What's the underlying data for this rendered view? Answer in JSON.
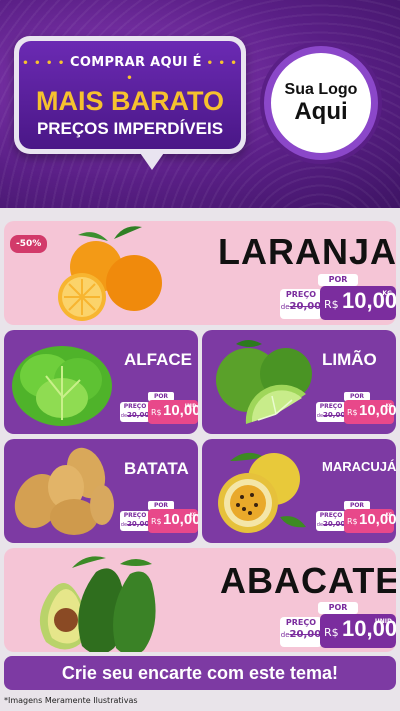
{
  "header": {
    "bubble_line1": "COMPRAR AQUI É",
    "bubble_dots_left": "• • • •",
    "bubble_dots_right": "• • • •",
    "bubble_line2": "MAIS BARATO",
    "bubble_line3": "PREÇOS IMPERDÍVEIS",
    "logo_line1": "Sua Logo",
    "logo_line2": "Aqui"
  },
  "products": {
    "laranja": {
      "name": "LARANJA",
      "discount": "-50%",
      "por": "POR",
      "preco": "PREÇO",
      "old_prefix": "de",
      "old_price": "20,00",
      "currency": "R$",
      "price": "10,00",
      "unit": "KG"
    },
    "alface": {
      "name": "ALFACE",
      "por": "POR",
      "preco": "PREÇO",
      "old_prefix": "de",
      "old_price": "20,00",
      "currency": "R$",
      "price": "10,00",
      "unit": "UNID"
    },
    "limao": {
      "name": "LIMÃO",
      "por": "POR",
      "preco": "PREÇO",
      "old_prefix": "de",
      "old_price": "20,00",
      "currency": "R$",
      "price": "10,00",
      "unit": "KG"
    },
    "batata": {
      "name": "BATATA",
      "por": "POR",
      "preco": "PREÇO",
      "old_prefix": "de",
      "old_price": "20,00",
      "currency": "R$",
      "price": "10,00",
      "unit": "KG"
    },
    "maracuja": {
      "name": "MARACUJÁ",
      "por": "POR",
      "preco": "PREÇO",
      "old_prefix": "de",
      "old_price": "20,00",
      "currency": "R$",
      "price": "10,00",
      "unit": "KG"
    },
    "abacate": {
      "name": "ABACATE",
      "por": "POR",
      "preco": "PREÇO",
      "old_prefix": "de",
      "old_price": "20,00",
      "currency": "R$",
      "price": "10,00",
      "unit": "UNID"
    }
  },
  "cta": "Crie seu encarte com este tema!",
  "footnote": "*Imagens Meramente Ilustrativas",
  "colors": {
    "purple": "#7d3aa3",
    "pink": "#f5c5d6",
    "accent_yellow": "#f6c22e",
    "price_pink": "#e8488a"
  }
}
